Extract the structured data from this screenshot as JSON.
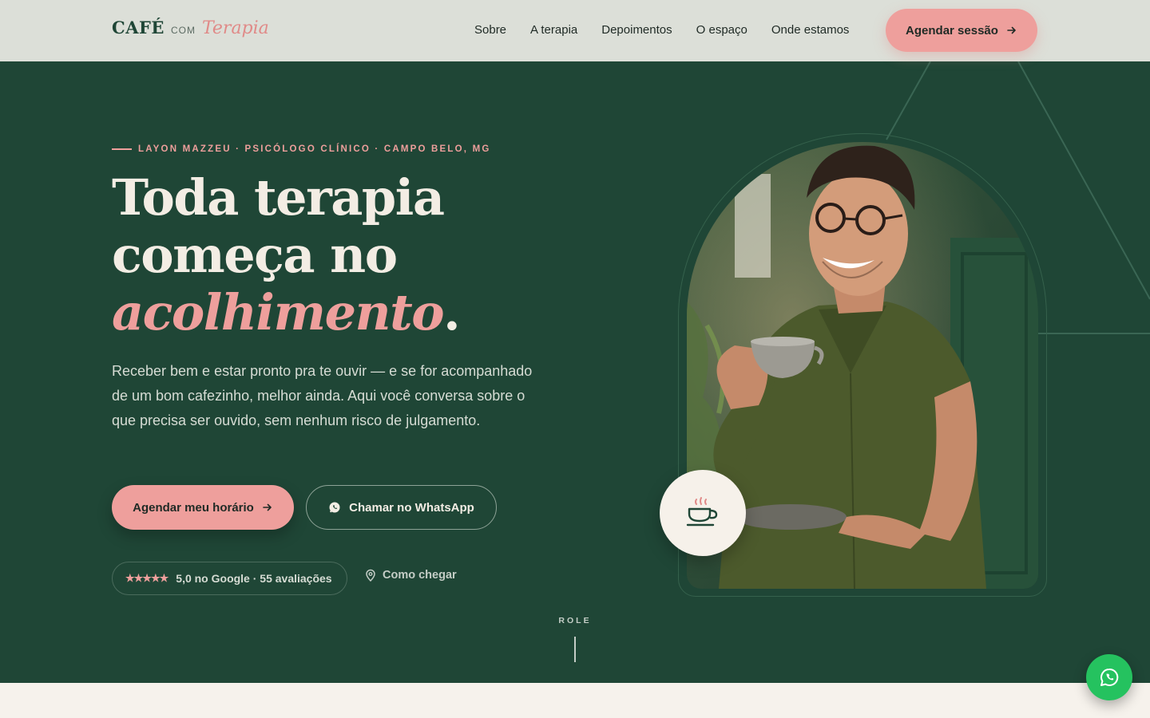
{
  "brand": {
    "cafe": "CAFÉ",
    "com": "COM",
    "terapia": "Terapia"
  },
  "nav": {
    "links": [
      "Sobre",
      "A terapia",
      "Depoimentos",
      "O espaço",
      "Onde estamos"
    ],
    "cta_label": "Agendar sessão"
  },
  "hero": {
    "eyebrow": "LAYON MAZZEU · PSICÓLOGO CLÍNICO · CAMPO BELO, MG",
    "headline_line1": "Toda terapia",
    "headline_line2": "começa no",
    "headline_accent": "acolhimento",
    "headline_period": ".",
    "lead": "Receber bem e estar pronto pra te ouvir — e se for acompanhado de um bom cafezinho, melhor ainda. Aqui você conversa sobre o que precisa ser ouvido, sem nenhum risco de julgamento.",
    "primary_cta": "Agendar meu horário",
    "secondary_cta": "Chamar no WhatsApp",
    "rating_stars": "★★★★★",
    "rating_text": "5,0 no Google · 55 avaliações",
    "directions": "Como chegar",
    "scroll_label": "ROLE"
  },
  "icons": [
    "arrow-right-icon",
    "whatsapp-icon",
    "map-pin-icon",
    "coffee-cup-icon"
  ],
  "colors": {
    "primary_green": "#1f4636",
    "accent_pink": "#ee9f9c",
    "cream": "#f3ede4",
    "whatsapp_green": "#25c25f"
  }
}
